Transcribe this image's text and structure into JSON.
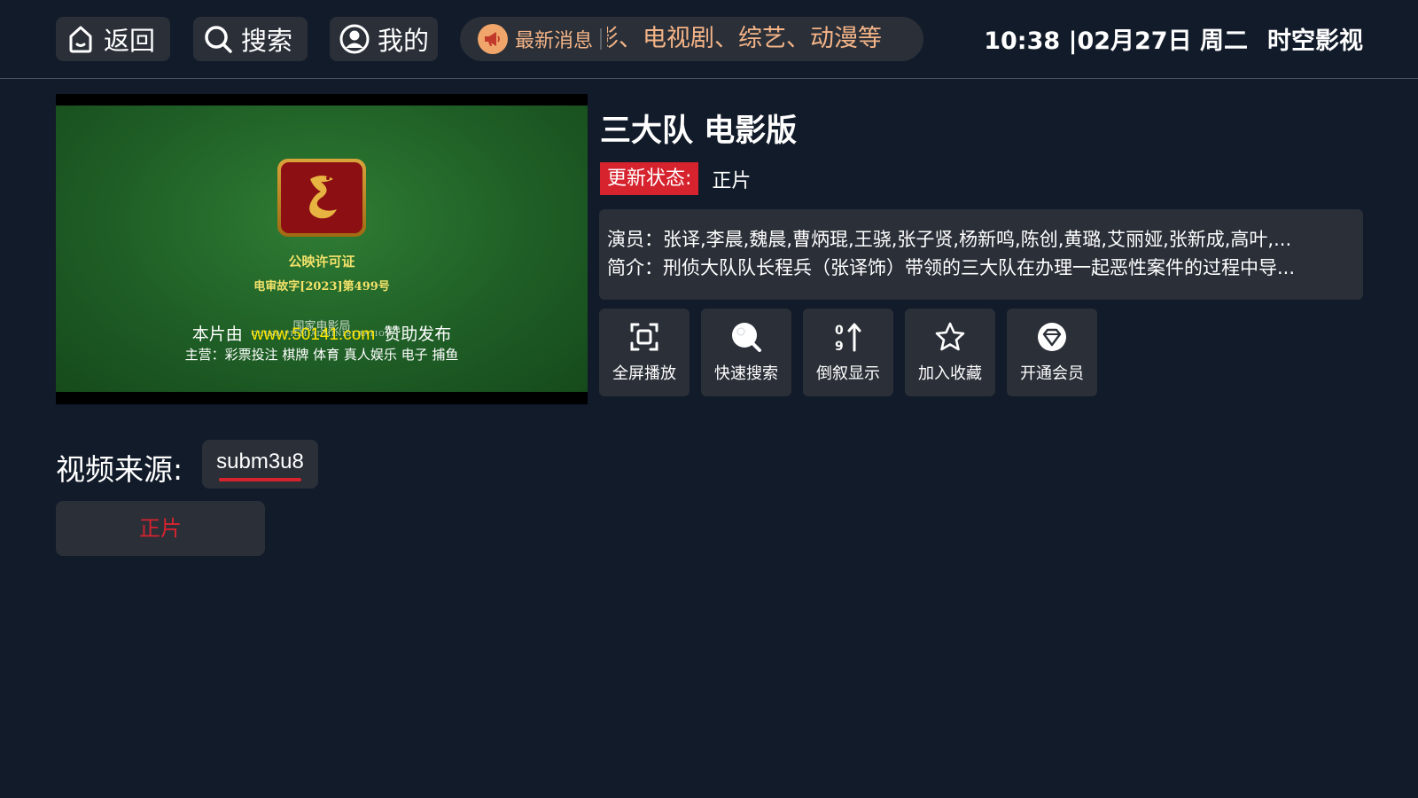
{
  "app_name": "时空影视",
  "topbar": {
    "back_label": "返回",
    "search_label": "搜索",
    "mine_label": "我的",
    "news_label": "最新消息",
    "news_ticker": "影、电视剧、综艺、动漫等",
    "time": "10:38 |02月27日 周二",
    "app_name": "时空影视"
  },
  "video": {
    "license_title": "公映许可证",
    "license_no": "电审故字[2023]第499号",
    "bureau": "国家电影局",
    "bureau_en": "CHINA FILM ADMINISTRATION",
    "sponsor_prefix": "本片由",
    "sponsor_site": "www.50141.com",
    "sponsor_suffix": "赞助发布",
    "business": "主营：彩票投注  棋牌  体育  真人娱乐  电子  捕鱼"
  },
  "detail": {
    "title": "三大队 电影版",
    "status_label": "更新状态:",
    "status_value": "正片",
    "actors_line": "演员：张译,李晨,魏晨,曹炳琨,王骁,张子贤,杨新鸣,陈创,黄璐,艾丽娅,张新成,高叶,...",
    "summary_line": "简介：刑侦大队队长程兵（张译饰）带领的三大队在办理一起恶性案件的过程中导..."
  },
  "actions": [
    {
      "label": "全屏播放",
      "icon": "fullscreen-icon"
    },
    {
      "label": "快速搜索",
      "icon": "search-icon"
    },
    {
      "label": "倒叙显示",
      "icon": "sort-icon"
    },
    {
      "label": "加入收藏",
      "icon": "star-icon"
    },
    {
      "label": "开通会员",
      "icon": "diamond-icon"
    }
  ],
  "source": {
    "label": "视频来源:",
    "selected": "subm3u8"
  },
  "episodes": [
    {
      "label": "正片",
      "active": true
    }
  ],
  "colors": {
    "background": "#121b29",
    "panel": "#2a2f38",
    "accent_red": "#d6232e",
    "news_orange": "#f4b487"
  }
}
